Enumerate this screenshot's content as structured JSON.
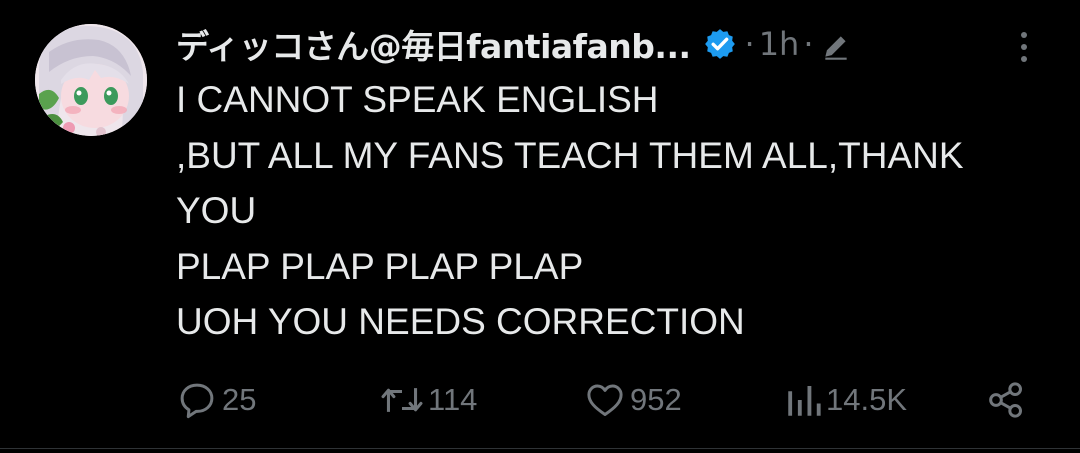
{
  "tweet": {
    "author": {
      "display_name": "ディッコさん@毎日fantiafanb...",
      "verified_icon": "verified-badge-icon",
      "verified_color": "#1d9bf0"
    },
    "meta": {
      "separator": "·",
      "time": "1h",
      "edit_icon": "pencil-icon"
    },
    "more_icon": "more-vertical-icon",
    "body_lines": [
      "I CANNOT SPEAK ENGLISH",
      ",BUT ALL MY FANS TEACH THEM ALL,THANK",
      "YOU",
      "PLAP PLAP PLAP PLAP",
      "UOH YOU NEEDS CORRECTION"
    ],
    "actions": {
      "reply": {
        "icon": "reply-icon",
        "count": "25"
      },
      "repost": {
        "icon": "repost-icon",
        "count": "114"
      },
      "like": {
        "icon": "heart-icon",
        "count": "952"
      },
      "views": {
        "icon": "views-icon",
        "count": "14.5K"
      },
      "share": {
        "icon": "share-icon"
      }
    }
  },
  "colors": {
    "background": "#000000",
    "text": "#e7e9ea",
    "muted": "#71767b",
    "accent": "#1d9bf0"
  }
}
